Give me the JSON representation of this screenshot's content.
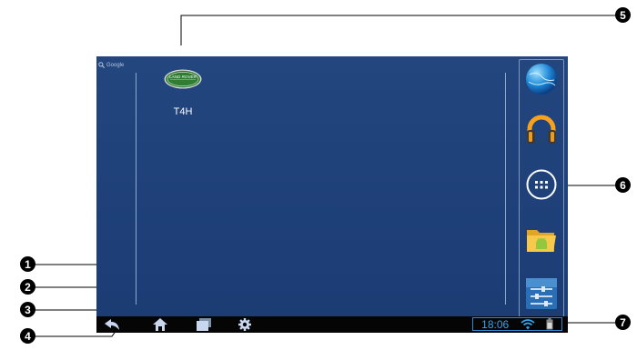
{
  "search": {
    "label": "Google"
  },
  "apps": [
    {
      "label": "T4H",
      "logo_text": "LAND ROVER"
    }
  ],
  "dock": {
    "items": [
      {
        "icon": "globe-icon"
      },
      {
        "icon": "headphones-icon"
      },
      {
        "icon": "app-drawer-icon"
      },
      {
        "icon": "folder-icon"
      },
      {
        "icon": "settings-sliders-icon"
      }
    ]
  },
  "navbar": {
    "buttons": [
      {
        "icon": "back-icon"
      },
      {
        "icon": "home-icon"
      },
      {
        "icon": "recent-apps-icon"
      },
      {
        "icon": "gear-icon"
      }
    ]
  },
  "status": {
    "time": "18:06",
    "icons": [
      "wifi-icon",
      "battery-icon"
    ]
  },
  "callouts": [
    "1",
    "2",
    "3",
    "4",
    "5",
    "6",
    "7"
  ],
  "colors": {
    "wallpaper": "#1d3f78",
    "navbar": "#050505",
    "clock": "#35a6ee",
    "logo": "#2e7d32"
  }
}
